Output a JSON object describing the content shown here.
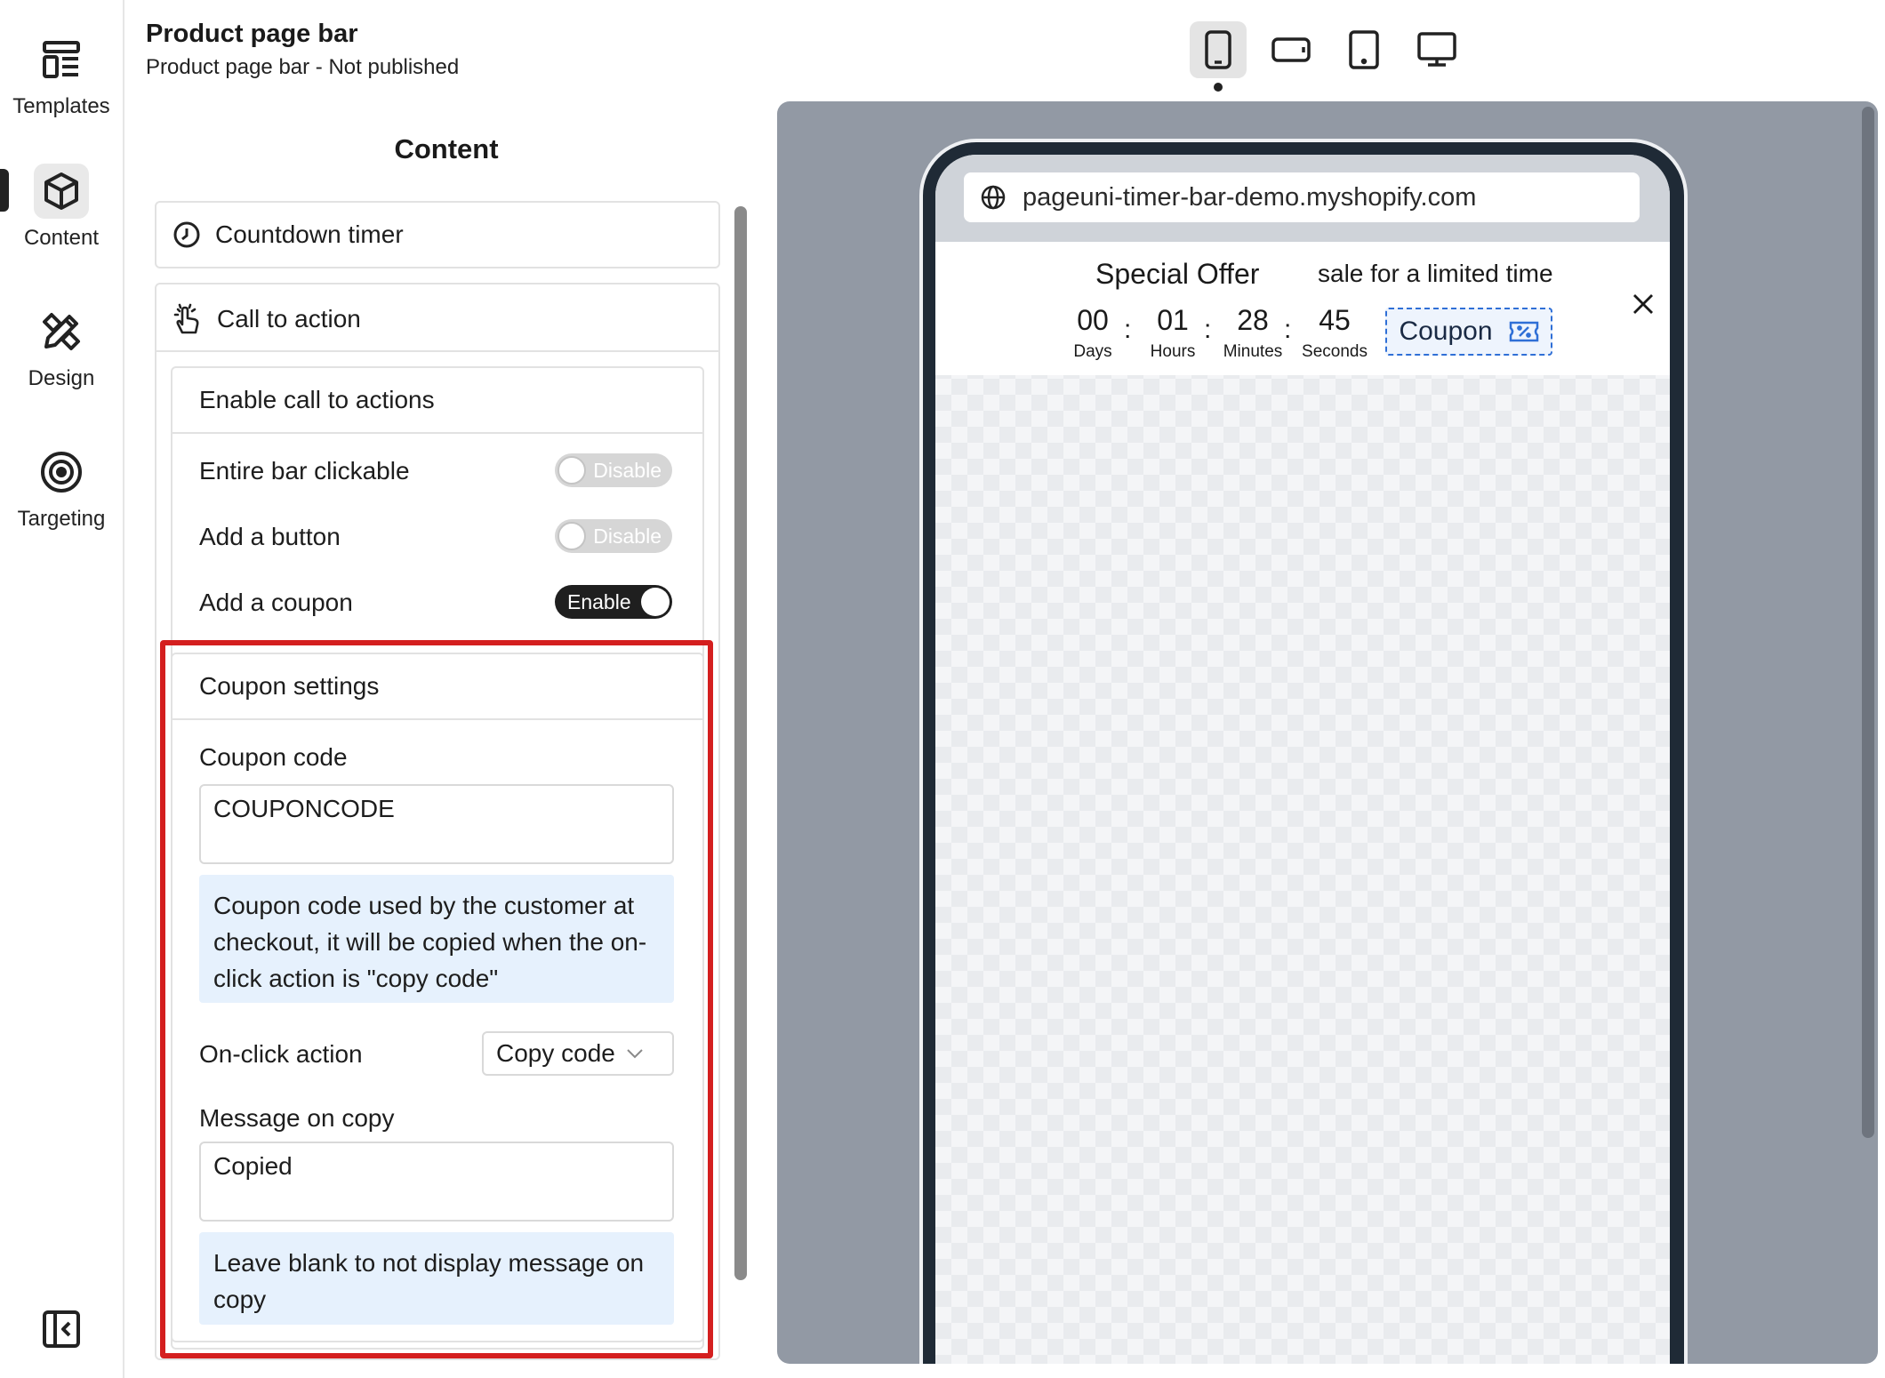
{
  "rail": {
    "items": [
      {
        "label": "Templates",
        "icon": "templates-icon"
      },
      {
        "label": "Content",
        "icon": "cube-icon",
        "active": true
      },
      {
        "label": "Design",
        "icon": "design-tools-icon"
      },
      {
        "label": "Targeting",
        "icon": "target-icon"
      }
    ],
    "collapse_icon": "sidebar-collapse-icon"
  },
  "header": {
    "title": "Product page bar",
    "subtitle": "Product page bar - Not published"
  },
  "panel": {
    "heading": "Content",
    "countdown_label": "Countdown timer",
    "cta_label": "Call to action",
    "enable_cta_label": "Enable call to actions",
    "toggles": [
      {
        "label": "Entire bar clickable",
        "state": "Disable"
      },
      {
        "label": "Add a button",
        "state": "Disable"
      },
      {
        "label": "Add a coupon",
        "state": "Enable"
      }
    ],
    "coupon": {
      "section_label": "Coupon settings",
      "code_label": "Coupon code",
      "code_value": "COUPONCODE",
      "code_help": "Coupon code used by the customer at checkout, it will be copied when the on-click action is \"copy code\"",
      "onclick_label": "On-click action",
      "onclick_value": "Copy code",
      "message_label": "Message on copy",
      "message_value": "Copied",
      "message_help": "Leave blank to not display message on copy"
    },
    "highlight_color": "#d41f1f"
  },
  "devices": [
    "mobile-icon",
    "tablet-landscape-icon",
    "tablet-icon",
    "desktop-icon"
  ],
  "preview": {
    "url": "pageuni-timer-bar-demo.myshopify.com",
    "offer_title": "Special Offer",
    "offer_subtitle": "sale for a limited time",
    "timer": [
      {
        "value": "00",
        "label": "Days"
      },
      {
        "value": "01",
        "label": "Hours"
      },
      {
        "value": "28",
        "label": "Minutes"
      },
      {
        "value": "45",
        "label": "Seconds"
      }
    ],
    "separator": ":",
    "coupon_label": "Coupon",
    "coupon_color": "#2f6fd6"
  }
}
